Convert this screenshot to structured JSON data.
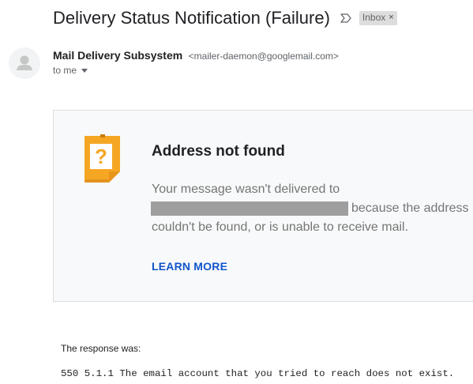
{
  "email": {
    "subject": "Delivery Status Notification (Failure)",
    "label": {
      "name": "Inbox",
      "remove_glyph": "×"
    },
    "importance_icon": "importance-marker-icon",
    "sender": {
      "name": "Mail Delivery Subsystem",
      "email": "<mailer-daemon@googlemail.com>",
      "avatar_icon": "person-icon"
    },
    "recipient_label": "to me"
  },
  "notice_card": {
    "icon": "question-note-icon",
    "title": "Address not found",
    "message_line1": "Your message wasn't delivered to",
    "message_line2": "because the address",
    "message_line3": "couldn't be found, or is unable to receive mail.",
    "learn_more": "LEARN MORE"
  },
  "response": {
    "label": "The response was:",
    "code": "550 5.1.1 The email account that you tried to reach does not exist."
  },
  "colors": {
    "link": "#1155cc",
    "note_orange": "#f5a623",
    "card_bg": "#f8f9fa",
    "redaction": "#9e9e9e"
  }
}
